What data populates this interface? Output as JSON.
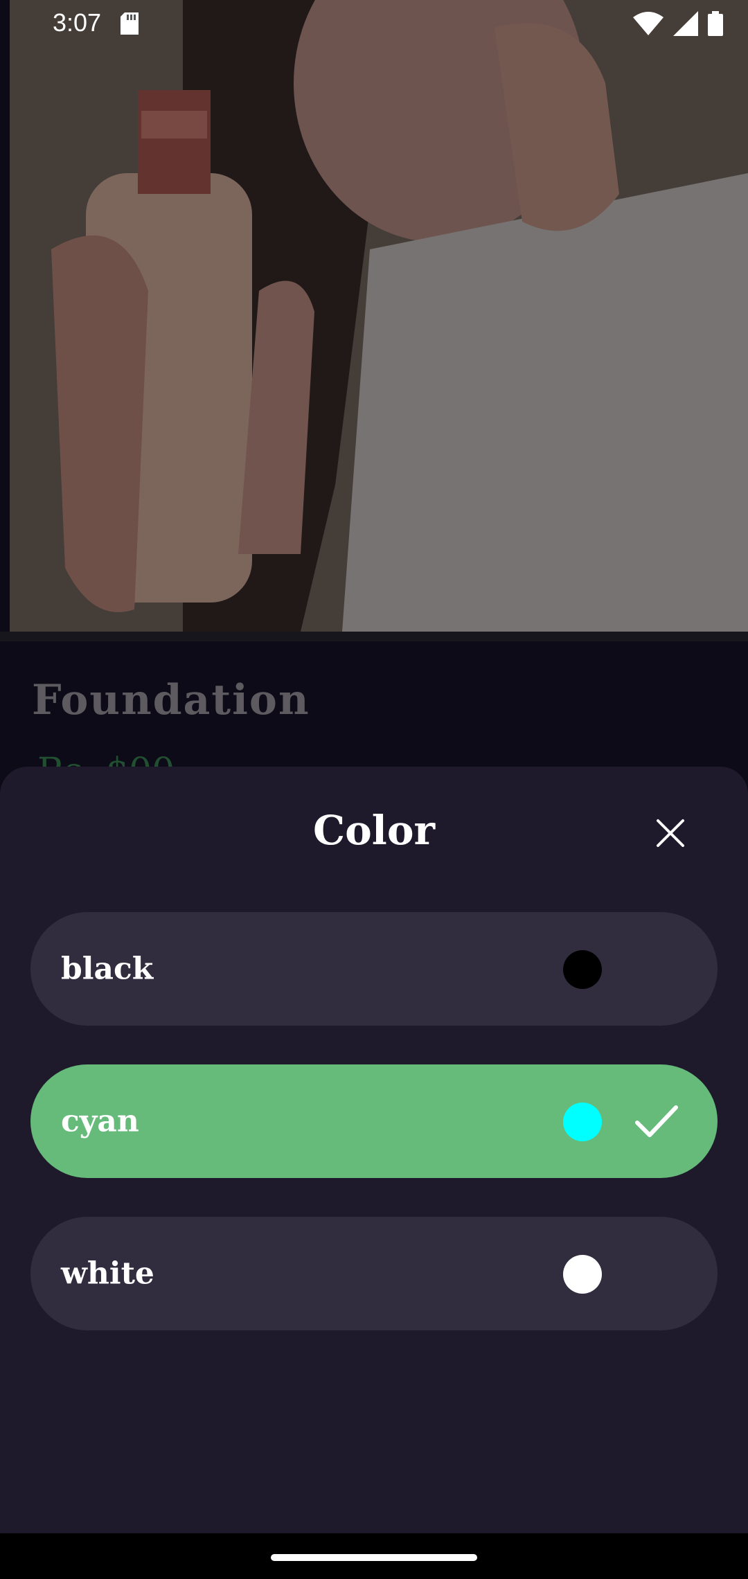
{
  "status_bar": {
    "time": "3:07",
    "icons": [
      "sd-card-icon",
      "wifi-icon",
      "signal-icon",
      "battery-icon"
    ]
  },
  "product": {
    "title": "Foundation",
    "price_partial": "Rs. $00",
    "image_description_icon": "product-photo"
  },
  "color_sheet": {
    "title": "Color",
    "close_icon": "close-icon",
    "options": [
      {
        "label": "black",
        "swatch_color": "#000000",
        "selected": false
      },
      {
        "label": "cyan",
        "swatch_color": "#00FFFF",
        "selected": true
      },
      {
        "label": "white",
        "swatch_color": "#FFFFFF",
        "selected": false
      }
    ]
  },
  "colors": {
    "sheet_background": "#1e1a2b",
    "option_background": "#312d3f",
    "selected_background": "#66bb7a",
    "price_green": "#3e8f5a"
  }
}
